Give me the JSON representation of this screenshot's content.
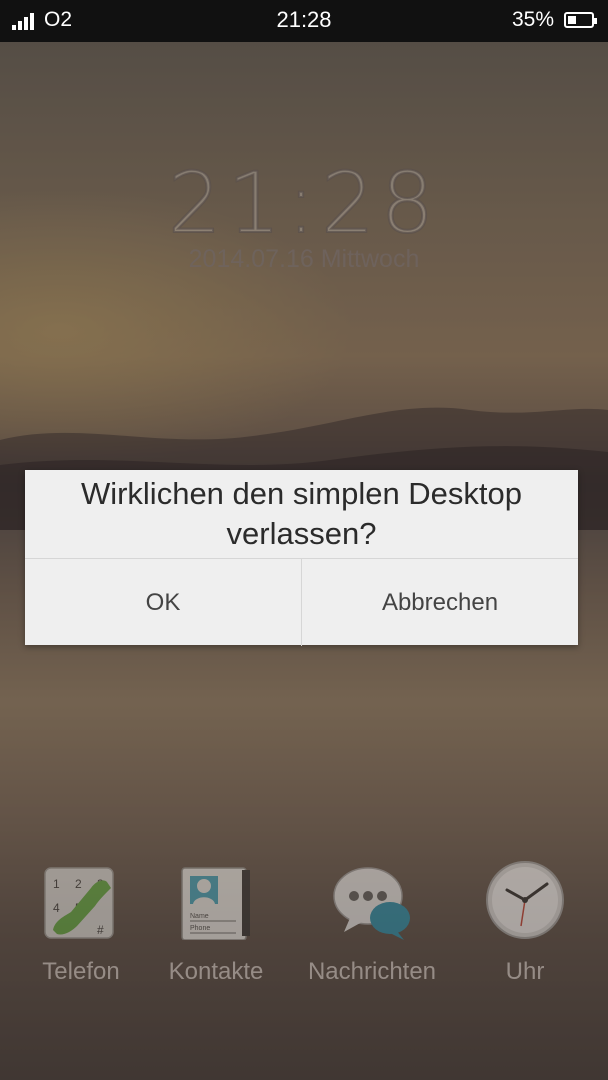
{
  "status_bar": {
    "carrier": "O2",
    "time": "21:28",
    "battery_percent_label": "35%",
    "battery_level": 0.35,
    "signal_bars": 4
  },
  "lockscreen": {
    "time": "21:28",
    "date": "2014.07.16 Mittwoch"
  },
  "dialog": {
    "message": "Wirklichen den simplen Desktop verlassen?",
    "ok_label": "OK",
    "cancel_label": "Abbrechen"
  },
  "dock": {
    "apps": [
      {
        "label": "Telefon",
        "icon": "phone-icon"
      },
      {
        "label": "Kontakte",
        "icon": "contacts-icon"
      },
      {
        "label": "Nachrichten",
        "icon": "messages-icon"
      },
      {
        "label": "Uhr",
        "icon": "clock-icon"
      }
    ],
    "phone_keys": [
      "1",
      "2",
      "3",
      "4",
      "5",
      "#"
    ],
    "contact_card_lines": [
      "Name",
      "Phone"
    ]
  },
  "colors": {
    "phone_green": "#5aa63a",
    "message_teal": "#1f8aa8",
    "dialog_bg": "#efefef",
    "status_bar_bg": "#111111"
  }
}
